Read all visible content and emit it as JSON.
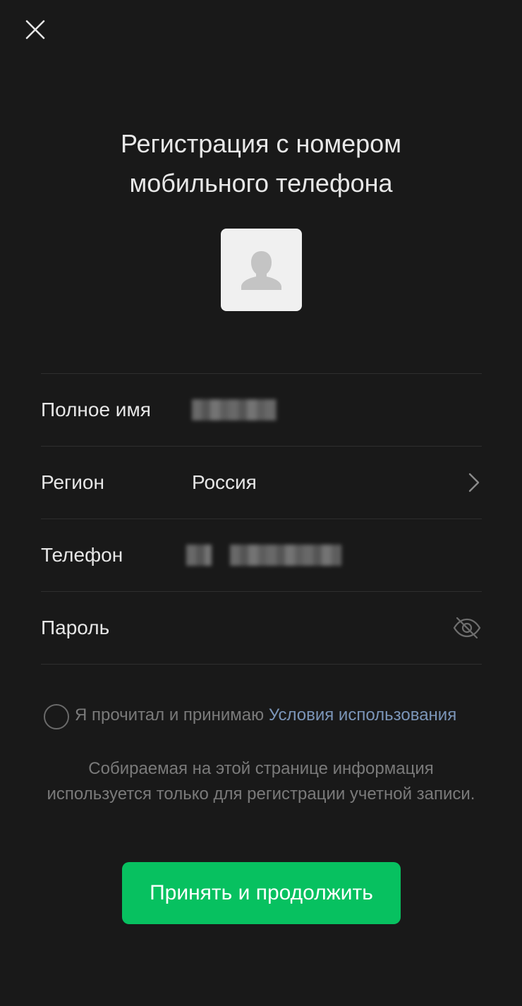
{
  "header": {
    "title_line1": "Регистрация с номером",
    "title_line2": "мобильного телефона",
    "close_icon": "close-icon"
  },
  "avatar": {
    "icon": "person-silhouette-icon",
    "background": "#f0f0f0"
  },
  "form": {
    "fullname": {
      "label": "Полное имя"
    },
    "region": {
      "label": "Регион",
      "value": "Россия",
      "icon": "chevron-right-icon"
    },
    "phone": {
      "label": "Телефон"
    },
    "password": {
      "label": "Пароль",
      "icon": "eye-off-icon"
    }
  },
  "agreement": {
    "prefix": "Я прочитал и принимаю ",
    "link": "Условия использования"
  },
  "notice": "Собираемая на этой странице информация используется только для регистрации учетной записи.",
  "primary_button": {
    "label": "Принять и продолжить",
    "color": "#07c160"
  },
  "colors": {
    "background": "#191919",
    "link": "#7b95b8",
    "muted_text": "#7a7a7a"
  }
}
